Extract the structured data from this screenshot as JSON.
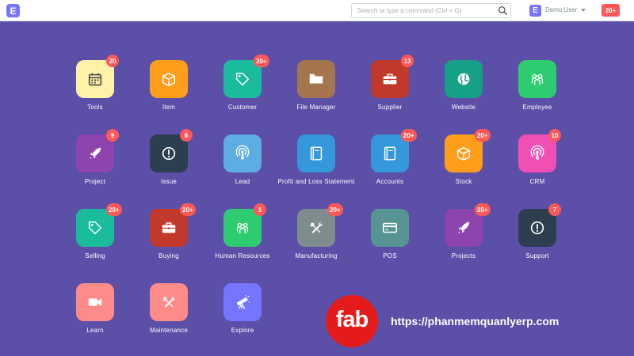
{
  "navbar": {
    "brand_letter": "E",
    "search_placeholder": "Search or type a command (Ctrl + G)",
    "user_letter": "E",
    "user_name": "Demo User",
    "notification_count": "20+"
  },
  "modules": [
    {
      "label": "Tools",
      "badge": "20",
      "color": "#fff1a8",
      "icon": "calendar-icon"
    },
    {
      "label": "Item",
      "badge": "",
      "color": "#ff9e1b",
      "icon": "box-icon"
    },
    {
      "label": "Customer",
      "badge": "20+",
      "color": "#1bbc9b",
      "icon": "tag-icon"
    },
    {
      "label": "File Manager",
      "badge": "",
      "color": "#a5764e",
      "icon": "folder-icon"
    },
    {
      "label": "Supplier",
      "badge": "13",
      "color": "#c0392b",
      "icon": "briefcase-icon"
    },
    {
      "label": "Website",
      "badge": "",
      "color": "#16a085",
      "icon": "globe-icon"
    },
    {
      "label": "Employee",
      "badge": "",
      "color": "#2ecc71",
      "icon": "users-icon"
    },
    {
      "label": "Project",
      "badge": "9",
      "color": "#8e44ad",
      "icon": "rocket-icon"
    },
    {
      "label": "Issue",
      "badge": "6",
      "color": "#2c3e50",
      "icon": "alert-icon"
    },
    {
      "label": "Lead",
      "badge": "",
      "color": "#5dade2",
      "icon": "broadcast-icon"
    },
    {
      "label": "Profit and Loss Statement",
      "badge": "",
      "color": "#3498db",
      "icon": "book-icon"
    },
    {
      "label": "Accounts",
      "badge": "20+",
      "color": "#3498db",
      "icon": "book-icon"
    },
    {
      "label": "Stock",
      "badge": "20+",
      "color": "#ff9e1b",
      "icon": "box-icon"
    },
    {
      "label": "CRM",
      "badge": "10",
      "color": "#f04fb4",
      "icon": "broadcast-icon"
    },
    {
      "label": "Selling",
      "badge": "20+",
      "color": "#1bbc9b",
      "icon": "tag-icon"
    },
    {
      "label": "Buying",
      "badge": "20+",
      "color": "#c0392b",
      "icon": "briefcase-icon"
    },
    {
      "label": "Human Resources",
      "badge": "1",
      "color": "#2ecc71",
      "icon": "users-icon"
    },
    {
      "label": "Manufacturing",
      "badge": "20+",
      "color": "#7f8c8d",
      "icon": "tools-icon"
    },
    {
      "label": "POS",
      "badge": "",
      "color": "#589494",
      "icon": "credit-card-icon"
    },
    {
      "label": "Projects",
      "badge": "20+",
      "color": "#8e44ad",
      "icon": "rocket-icon"
    },
    {
      "label": "Support",
      "badge": "7",
      "color": "#2c3e50",
      "icon": "alert-icon"
    },
    {
      "label": "Learn",
      "badge": "",
      "color": "#ff8a8a",
      "icon": "video-icon"
    },
    {
      "label": "Maintenance",
      "badge": "",
      "color": "#ff8a8a",
      "icon": "tools-icon"
    },
    {
      "label": "Explore",
      "badge": "",
      "color": "#7575ff",
      "icon": "telescope-icon"
    }
  ],
  "watermark": {
    "logo_text": "fab",
    "url": "https://phanmemquanlyerp.com"
  }
}
